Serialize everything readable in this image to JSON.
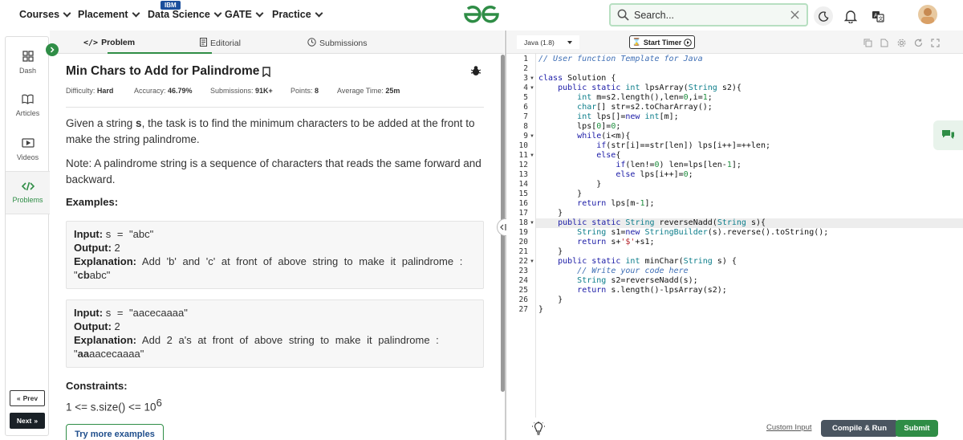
{
  "nav": {
    "items": [
      {
        "label": "Courses"
      },
      {
        "label": "Placement"
      },
      {
        "label": "Data Science"
      },
      {
        "label": "GATE"
      },
      {
        "label": "Practice"
      }
    ],
    "ibm_badge": "IBM",
    "search_placeholder": "Search..."
  },
  "sidebar": {
    "items": [
      {
        "label": "Dash",
        "icon": "grid-icon"
      },
      {
        "label": "Articles",
        "icon": "book-icon"
      },
      {
        "label": "Videos",
        "icon": "video-icon"
      },
      {
        "label": "Problems",
        "icon": "code-icon",
        "active": true
      }
    ],
    "prev_label": "Prev",
    "next_label": "Next"
  },
  "tabs": [
    {
      "label": "Problem",
      "active": true
    },
    {
      "label": "Editorial"
    },
    {
      "label": "Submissions"
    }
  ],
  "problem": {
    "title": "Min Chars to Add for Palindrome",
    "meta": [
      {
        "key": "Difficulty:",
        "value": "Hard"
      },
      {
        "key": "Accuracy:",
        "value": "46.79%"
      },
      {
        "key": "Submissions:",
        "value": "91K+"
      },
      {
        "key": "Points:",
        "value": "8"
      },
      {
        "key": "Average Time:",
        "value": "25m"
      }
    ],
    "desc_pre": "Given a string ",
    "desc_var": "s",
    "desc_post": ", the task is to find the minimum characters to be added at the front to make the string palindrome.",
    "note": "Note: A palindrome string is a sequence of characters that reads the same forward and backward.",
    "examples_heading": "Examples:",
    "examples": [
      {
        "input_label": "Input:",
        "input": "s = \"abc\"",
        "output_label": "Output:",
        "output": "2",
        "expl_label": "Explanation:",
        "expl": "Add 'b' and 'c' at front of above string to make it palindrome :",
        "expl2_prefix": "\"",
        "expl2_bold": "cb",
        "expl2_rest": "abc\""
      },
      {
        "input_label": "Input:",
        "input": "s = \"aacecaaaa\"",
        "output_label": "Output:",
        "output": "2",
        "expl_label": "Explanation:",
        "expl": "Add 2 a's at front of above string to make it palindrome :",
        "expl2_prefix": "\"",
        "expl2_bold": "aa",
        "expl2_rest": "aacecaaaa\""
      }
    ],
    "constraints_heading": "Constraints:",
    "constraint_text": "1 <= s.size() <= 10",
    "constraint_sup": "6",
    "try_more": "Try more examples"
  },
  "editor": {
    "language": "Java (1.8)",
    "timer_label": "Start Timer",
    "custom_input": "Custom Input",
    "compile_run": "Compile & Run",
    "submit": "Submit",
    "current_line": 18,
    "fold_lines": [
      3,
      4,
      9,
      11,
      18,
      22
    ],
    "lines": [
      "// User function Template for Java",
      "",
      "class Solution {",
      "    public static int lpsArray(String s2){",
      "        int m=s2.length(),len=0,i=1;",
      "        char[] str=s2.toCharArray();",
      "        int lps[]=new int[m];",
      "        lps[0]=0;",
      "        while(i<m){",
      "            if(str[i]==str[len]) lps[i++]=++len;",
      "            else{",
      "                if(len!=0) len=lps[len-1];",
      "                else lps[i++]=0;",
      "            }",
      "        }",
      "        return lps[m-1];",
      "    }",
      "    public static String reverseNadd(String s){",
      "        String s1=new StringBuilder(s).reverse().toString();",
      "        return s+'$'+s1;",
      "    }",
      "    public static int minChar(String s) {",
      "        // Write your code here",
      "        String s2=reverseNadd(s);",
      "        return s.length()-lpsArray(s2);",
      "    }",
      "}"
    ]
  },
  "colors": {
    "brand_green": "#2f8d46",
    "dark": "#1a2127"
  }
}
